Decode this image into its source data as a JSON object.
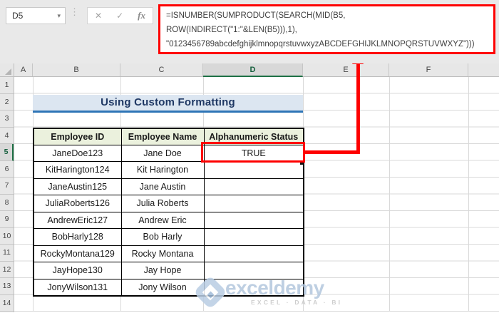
{
  "formula_bar": {
    "name_box_value": "D5",
    "formula": "=ISNUMBER(SUMPRODUCT(SEARCH(MID(B5,\nROW(INDIRECT(\"1:\"&LEN(B5))),1),\n\"0123456789abcdefghijklmnopqrstuvwxyzABCDEFGHIJKLMNOPQRSTUVWXYZ\")))",
    "icons": {
      "dropdown": "▾",
      "dots": "⋮",
      "cancel": "✕",
      "enter": "✓",
      "fx": "fx"
    }
  },
  "grid": {
    "selected_cell": "D5",
    "column_headers": [
      "A",
      "B",
      "C",
      "D",
      "E",
      "F"
    ],
    "row_headers": [
      "1",
      "2",
      "3",
      "4",
      "5",
      "6",
      "7",
      "8",
      "9",
      "10",
      "11",
      "12",
      "13",
      "14"
    ]
  },
  "sheet": {
    "title": "Using Custom Formatting",
    "table": {
      "headers": [
        "Employee ID",
        "Employee Name",
        "Alphanumeric Status"
      ],
      "rows": [
        {
          "id": "JaneDoe123",
          "name": "Jane Doe",
          "status": "TRUE"
        },
        {
          "id": "KitHarington124",
          "name": "Kit Harington",
          "status": ""
        },
        {
          "id": "JaneAustin125",
          "name": "Jane Austin",
          "status": ""
        },
        {
          "id": "JuliaRoberts126",
          "name": "Julia Roberts",
          "status": ""
        },
        {
          "id": "AndrewEric127",
          "name": "Andrew Eric",
          "status": ""
        },
        {
          "id": "BobHarly128",
          "name": "Bob Harly",
          "status": ""
        },
        {
          "id": "RockyMontana129",
          "name": "Rocky Montana",
          "status": ""
        },
        {
          "id": "JayHope130",
          "name": "Jay Hope",
          "status": ""
        },
        {
          "id": "JonyWilson131",
          "name": "Jony Wilson",
          "status": ""
        }
      ]
    }
  },
  "watermark": {
    "brand": "exceldemy",
    "tagline": "EXCEL · DATA · BI"
  },
  "colors": {
    "annotation_red": "#fe0000",
    "excel_green": "#1e7145",
    "banner_bg": "#dce6f1",
    "banner_border": "#2e75b6",
    "title_text": "#1f3864",
    "table_header_bg": "#ebf1dd"
  }
}
